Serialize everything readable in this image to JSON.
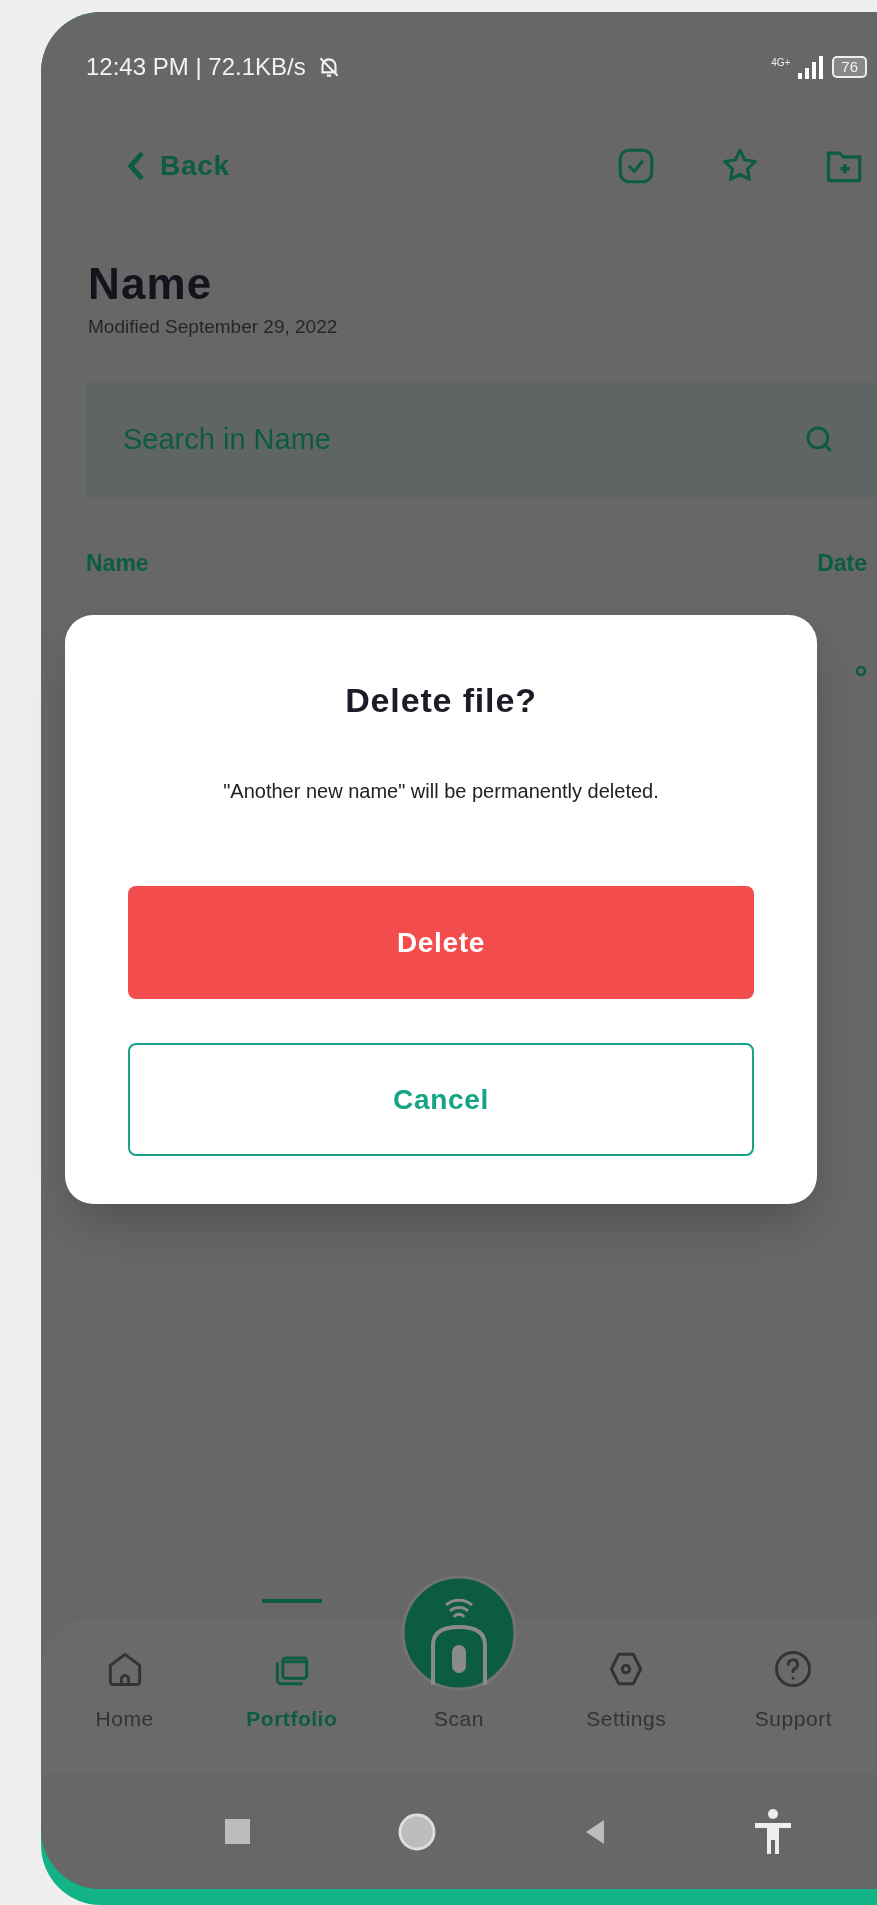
{
  "status_bar": {
    "time_speed": "12:43 PM | 72.1KB/s",
    "network": "4G+",
    "battery": "76"
  },
  "header": {
    "back": "Back",
    "title": "Name",
    "modified": "Modified September 29, 2022"
  },
  "search": {
    "placeholder": "Search in Name"
  },
  "list": {
    "columns": [
      "Name",
      "Date"
    ]
  },
  "dialog": {
    "title": "Delete file?",
    "message": "\"Another new name\" will be permanently deleted.",
    "buttons": [
      {
        "label": "Delete",
        "kind": "danger"
      },
      {
        "label": "Cancel",
        "kind": "outline"
      }
    ]
  },
  "tab_bar": [
    {
      "label": "Home",
      "kind": "home",
      "selected": false
    },
    {
      "label": "Portfolio",
      "kind": "portfolio",
      "selected": true
    },
    {
      "label": "Scan",
      "kind": "scan",
      "selected": false
    },
    {
      "label": "Settings",
      "kind": "settings",
      "selected": false
    },
    {
      "label": "Support",
      "kind": "support",
      "selected": false
    }
  ]
}
